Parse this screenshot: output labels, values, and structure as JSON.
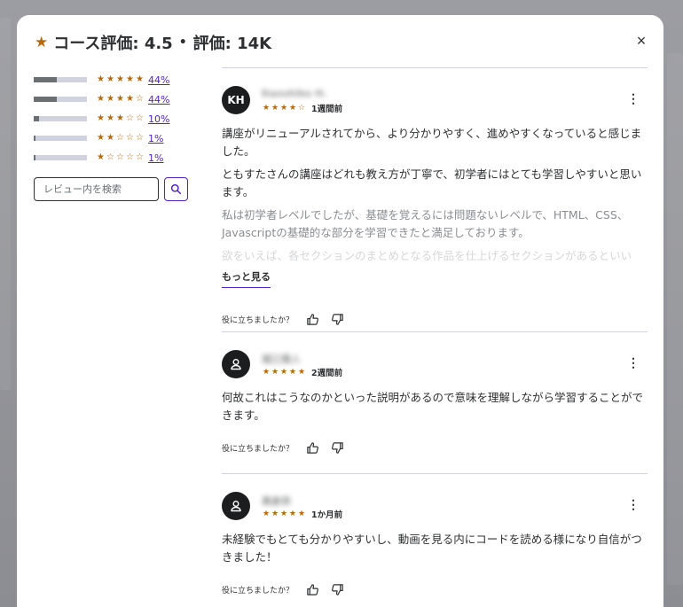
{
  "header": {
    "title": "コース評価: 4.5",
    "separator": "•",
    "subtitle": "評価: 14K",
    "close_label": "×"
  },
  "distribution": [
    {
      "stars": 5,
      "percent_label": "44%",
      "fill": 0.44
    },
    {
      "stars": 4,
      "percent_label": "44%",
      "fill": 0.44
    },
    {
      "stars": 3,
      "percent_label": "10%",
      "fill": 0.1
    },
    {
      "stars": 2,
      "percent_label": "1%",
      "fill": 0.01
    },
    {
      "stars": 1,
      "percent_label": "1%",
      "fill": 0.01
    }
  ],
  "search": {
    "placeholder": "レビュー内を検索",
    "button_icon": "search-icon"
  },
  "reviews": [
    {
      "avatar_initials": "KH",
      "name": "Kazuhiko H.",
      "rating": 4,
      "date": "1週間前",
      "paragraphs": [
        "講座がリニューアルされてから、より分かりやすく、進めやすくなっていると感じました。",
        "ともすたさんの講座はどれも教え方が丁寧で、初学者にはとても学習しやすいと思います。"
      ],
      "faded_paragraph": "私は初学者レベルでしたが、基礎を覚えるには問題ないレベルで、HTML、CSS、Javascriptの基礎的な部分を学習できたと満足しております。",
      "faded_paragraph_2": "欲をいえば、各セクションのまとめとなる作品を仕上げるセクションがあるといい",
      "show_more": "もっと見る",
      "helpful_question": "役に立ちましたか？"
    },
    {
      "avatar_initials": "",
      "name": "堀江雅人",
      "rating": 5,
      "date": "2週間前",
      "paragraphs": [
        "何故これはこうなのかといった説明があるので意味を理解しながら学習することができます。"
      ],
      "helpful_question": "役に立ちましたか？"
    },
    {
      "avatar_initials": "",
      "name": "高倉奈",
      "rating": 5,
      "date": "1か月前",
      "paragraphs": [
        "未経験でもとても分かりやすいし、動画を見る内にコードを読める様になり自信がつきました！"
      ],
      "helpful_question": "役に立ちましたか？"
    }
  ],
  "colors": {
    "star": "#b4690e",
    "link": "#5022c3",
    "bar_track": "#d1d2e0",
    "bar_fill": "#6a6f73"
  }
}
